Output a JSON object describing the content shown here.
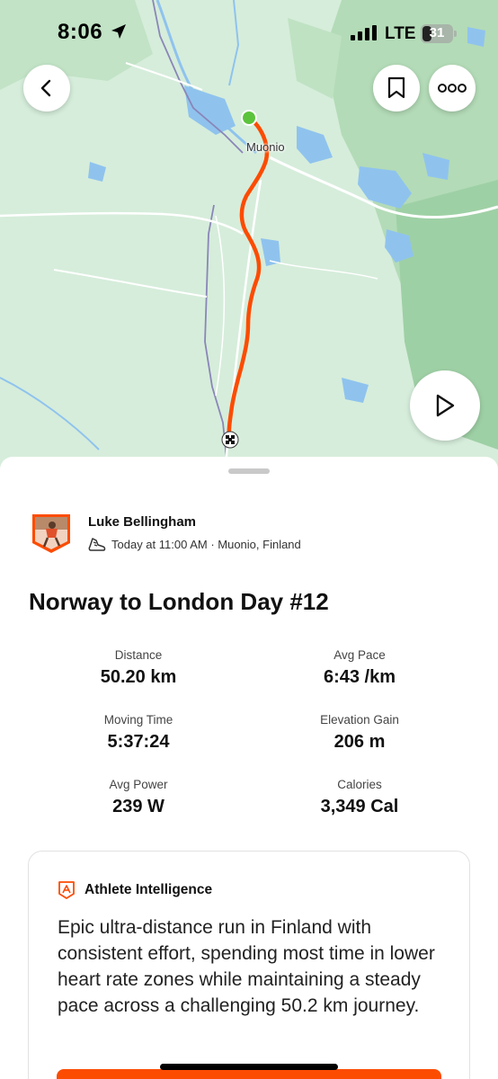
{
  "status_bar": {
    "time": "8:06",
    "network": "LTE",
    "battery": "31"
  },
  "map": {
    "place_label": "Muonio",
    "route_color": "#fc4c02",
    "start_color": "#5cc33d"
  },
  "icons": {
    "back": "chevron-left-icon",
    "bookmark": "bookmark-icon",
    "more": "more-dots-icon",
    "play": "play-icon",
    "shoe": "run-shoe-icon",
    "ai": "athlete-intelligence-icon"
  },
  "athlete": {
    "name": "Luke Bellingham",
    "meta": "Today at 11:00 AM · Muonio, Finland"
  },
  "activity": {
    "title": "Norway to London Day #12"
  },
  "stats": [
    {
      "label": "Distance",
      "value": "50.20 km"
    },
    {
      "label": "Avg Pace",
      "value": "6:43 /km"
    },
    {
      "label": "Moving Time",
      "value": "5:37:24"
    },
    {
      "label": "Elevation Gain",
      "value": "206 m"
    },
    {
      "label": "Avg Power",
      "value": "239 W"
    },
    {
      "label": "Calories",
      "value": "3,349 Cal"
    }
  ],
  "insight": {
    "title": "Athlete Intelligence",
    "body": "Epic ultra-distance run in Finland with consistent effort, spending most time in lower heart rate zones while maintaining a steady pace across a challenging 50.2 km journey."
  },
  "colors": {
    "accent": "#fc4c02",
    "map_base": "#d4ecd9",
    "water": "#8fc3ee",
    "forest": "#a9d6ae"
  }
}
